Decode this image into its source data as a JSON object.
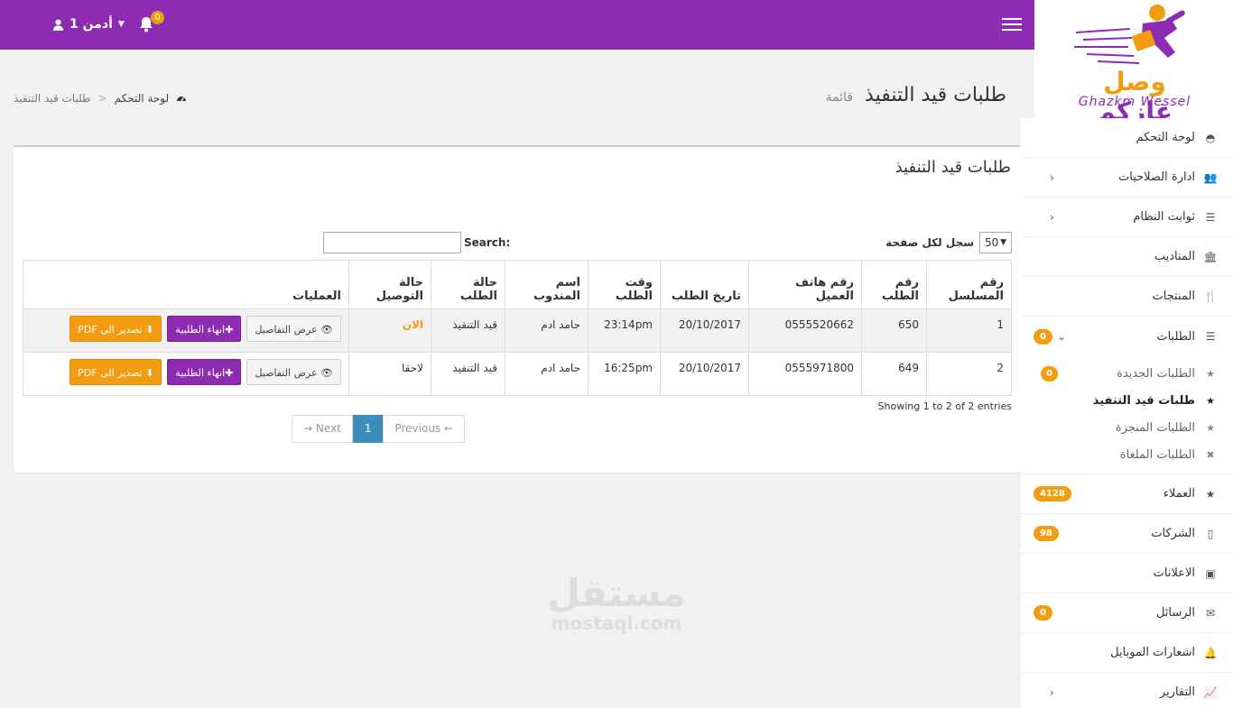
{
  "topbar": {
    "user_name": "أدمن 1",
    "notification_count": "0"
  },
  "logo": {
    "ar_part1": "غازكم",
    "ar_part2": "وصل",
    "en": "Ghazkm Wessel"
  },
  "page": {
    "title": "طلبات قيد التنفيذ",
    "subtitle": "قائمة"
  },
  "breadcrumb": {
    "home": "لوحة التحكم",
    "current": "طلبات قيد التنفيذ"
  },
  "box": {
    "title": "طلبات قيد التنفيذ",
    "length_value": "50",
    "length_label": "سجل لكل صفحة",
    "search_label": "Search:",
    "info": "Showing 1 to 2 of 2 entries"
  },
  "table": {
    "headers": [
      "رقم المسلسل",
      "رقم الطلب",
      "رقم هاتف العميل",
      "تاريخ الطلب",
      "وقت الطلب",
      "اسم المندوب",
      "حالة الطلب",
      "حالة التوصيل",
      "العمليات"
    ],
    "rows": [
      {
        "serial": "1",
        "order_no": "650",
        "phone": "0555520662",
        "date": "20/10/2017",
        "time": "23:14pm",
        "agent": "حامد ادم",
        "status": "قيد التنفيذ",
        "delivery": "الان"
      },
      {
        "serial": "2",
        "order_no": "649",
        "phone": "0555971800",
        "date": "20/10/2017",
        "time": "16:25pm",
        "agent": "حامد ادم",
        "status": "قيد التنفيذ",
        "delivery": "لاحقا"
      }
    ],
    "btn_view": "عرض التفاصيل",
    "btn_end": "انهاء الطلبية",
    "btn_pdf": "تصدير الى PDF"
  },
  "pager": {
    "prev": "Previous ←",
    "page": "1",
    "next": "→ Next"
  },
  "watermark": {
    "ar": "مستقل",
    "en": "mostaql.com"
  },
  "sidebar": {
    "items": [
      {
        "label": "لوحة التحكم"
      },
      {
        "label": "ادارة الصلاحيات"
      },
      {
        "label": "ثوابت النظام"
      },
      {
        "label": "المناديب"
      },
      {
        "label": "المنتجات"
      },
      {
        "label": "الطلبات",
        "badge": "0"
      },
      {
        "label": "العملاء",
        "badge": "4128"
      },
      {
        "label": "الشركات",
        "badge": "98"
      },
      {
        "label": "الاعلانات"
      },
      {
        "label": "الرسائل",
        "badge": "0"
      },
      {
        "label": "اشعارات الموبايل"
      },
      {
        "label": "التقارير"
      }
    ],
    "sub_items": [
      {
        "label": "الطلبات الجديدة",
        "badge": "0"
      },
      {
        "label": "طلبات قيد التنفيذ"
      },
      {
        "label": "الطلبات المنجزة"
      },
      {
        "label": "الطلبات الملغاة"
      }
    ]
  },
  "colors": {
    "brand_purple": "#8e2bb3",
    "accent_orange": "#f39c12",
    "pager_blue": "#3c8dbc"
  }
}
